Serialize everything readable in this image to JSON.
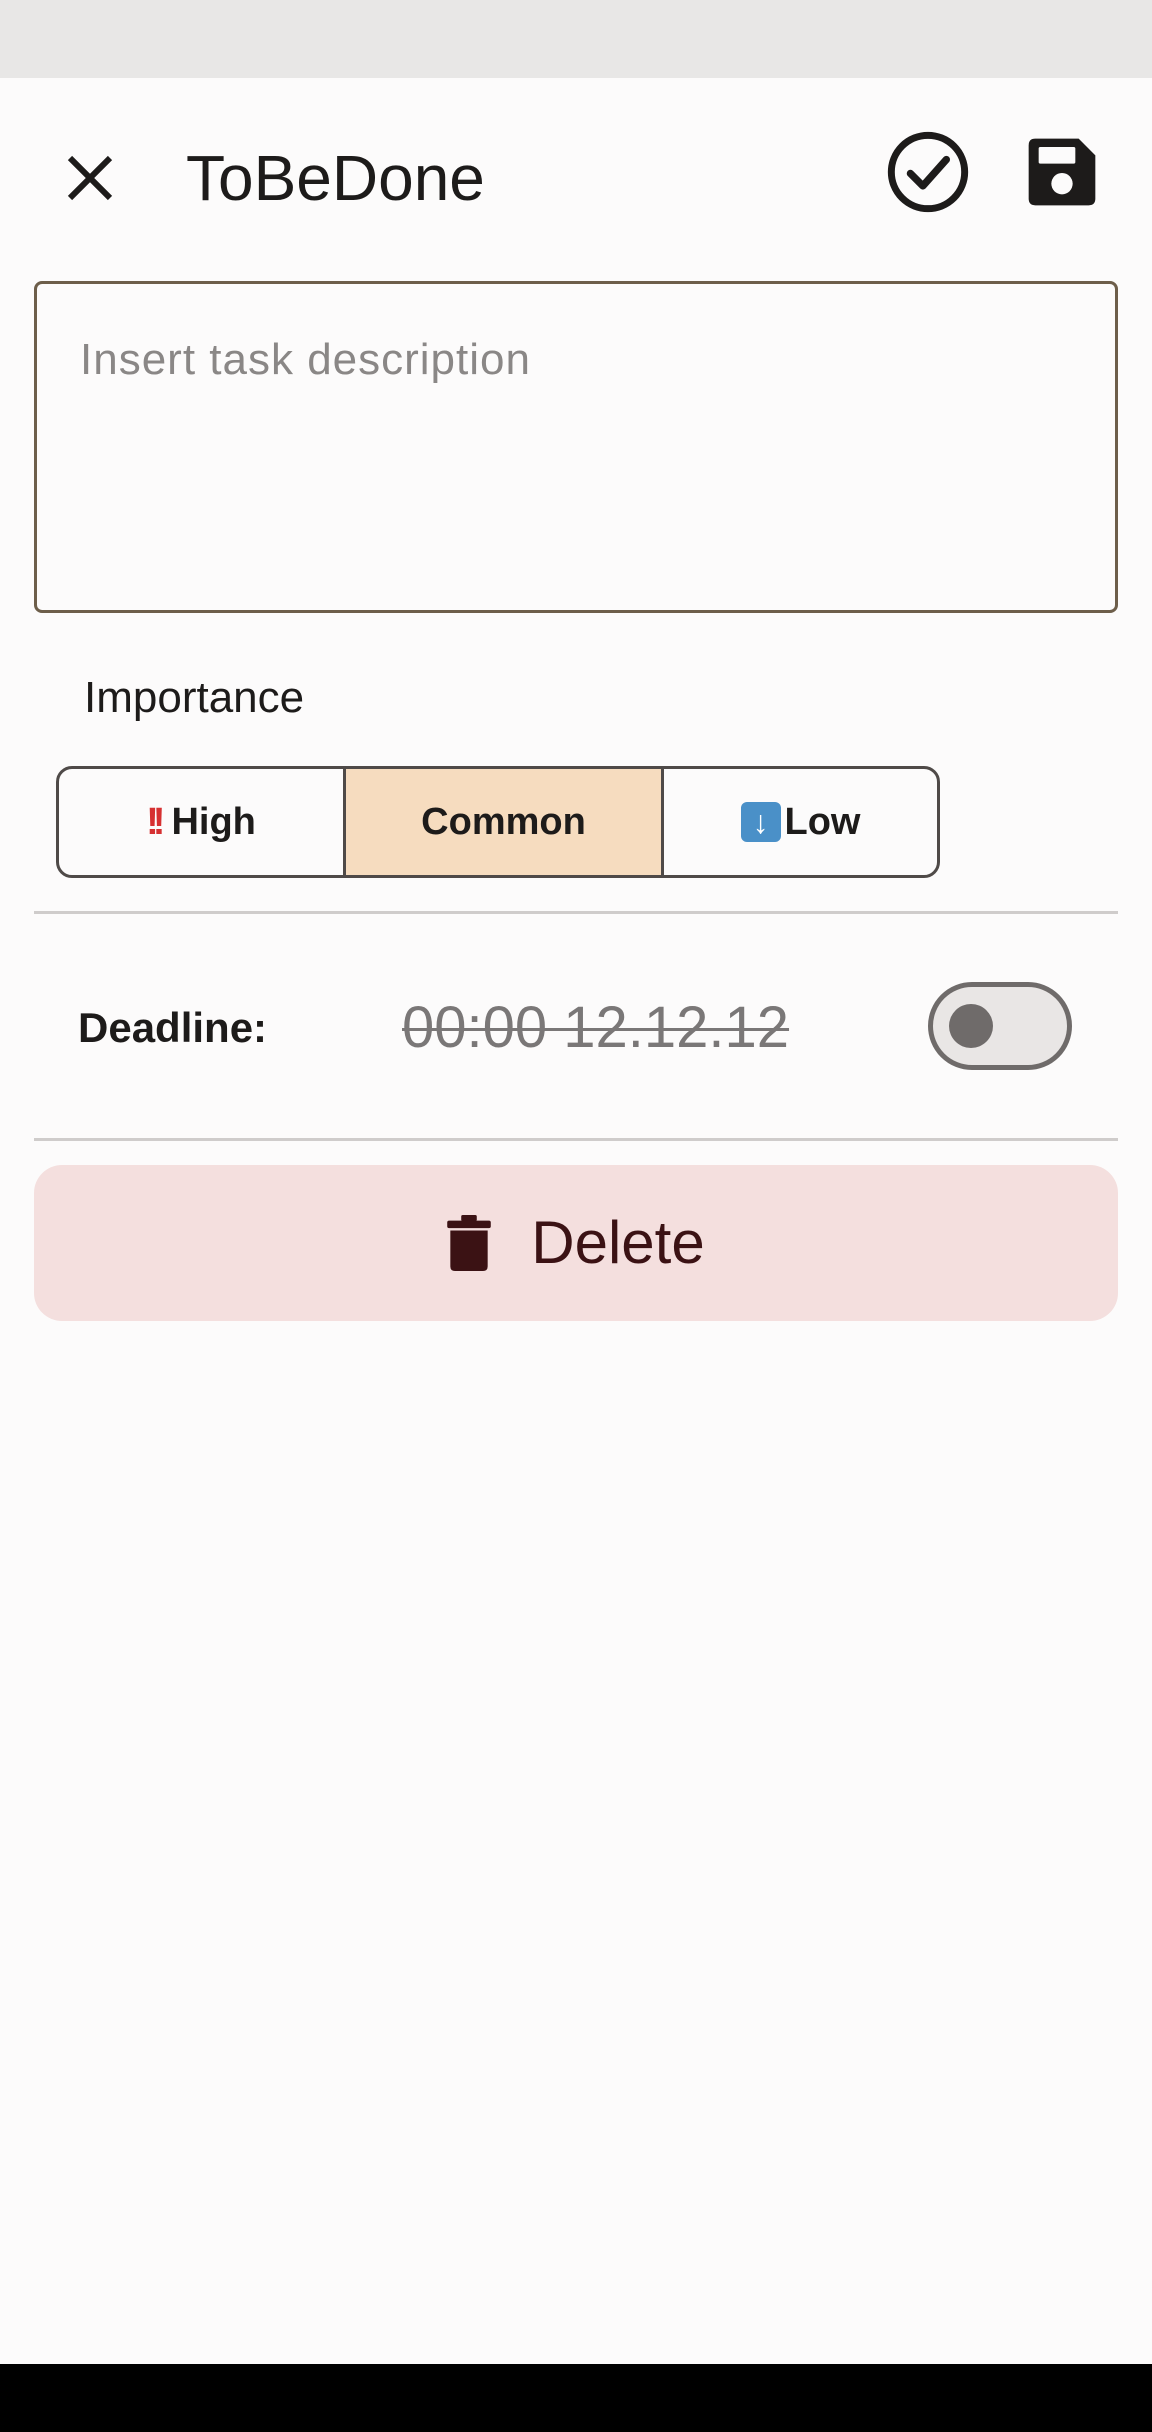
{
  "app_bar": {
    "title": "ToBeDone",
    "close_icon": "close-icon",
    "done_icon": "check-circle-icon",
    "save_icon": "save-icon"
  },
  "task": {
    "description_value": "",
    "description_placeholder": "Insert task description"
  },
  "importance": {
    "label": "Importance",
    "options": [
      {
        "glyph": "‼️",
        "label": "High",
        "selected": false
      },
      {
        "glyph": "⬇️",
        "label": "Low",
        "selected": false
      },
      {
        "glyph": "",
        "label": "Common",
        "selected": true
      }
    ],
    "high_label": "High",
    "common_label": "Common",
    "low_label": "Low",
    "selected": "Common",
    "selected_color": "#f6dcbf"
  },
  "deadline": {
    "label": "Deadline:",
    "value": "00:00 12.12.12",
    "enabled": false
  },
  "delete": {
    "label": "Delete",
    "icon": "trash-icon",
    "background": "#f4dfde",
    "text_color": "#3b1214"
  },
  "colors": {
    "background": "#fcfbfb",
    "outline": "#6d5e4a",
    "divider": "#cfcccb"
  }
}
